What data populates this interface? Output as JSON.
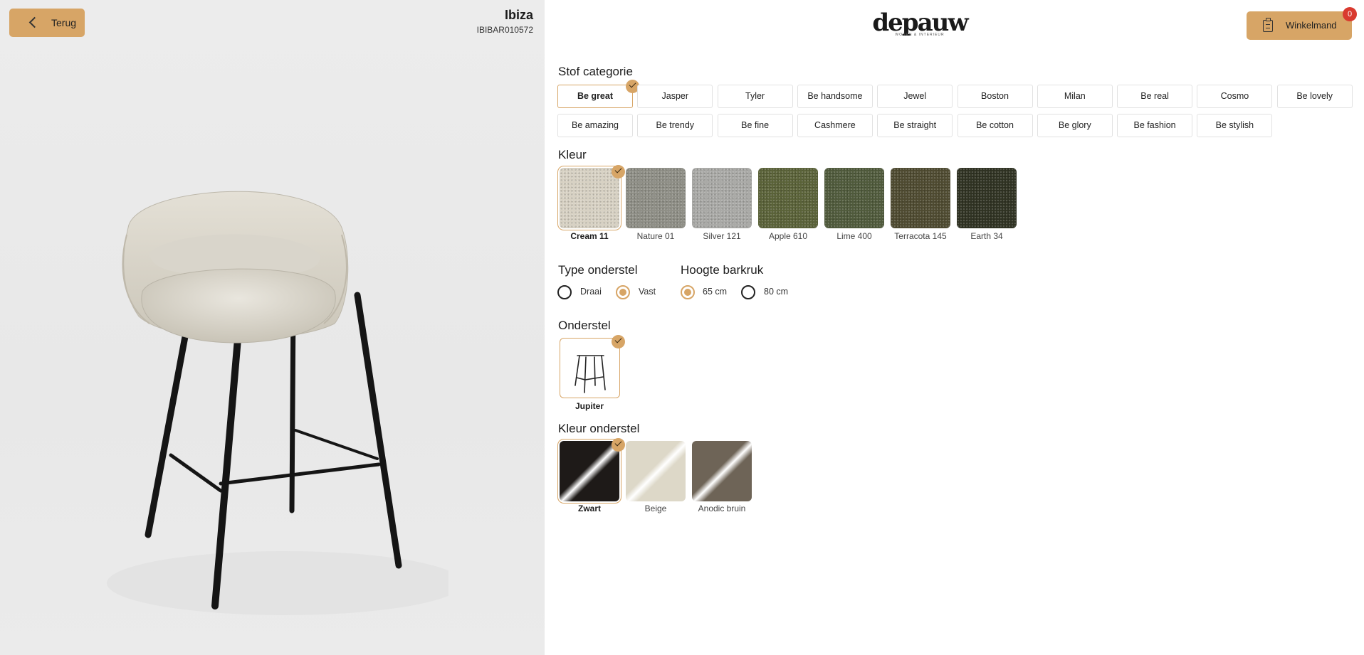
{
  "header": {
    "back_label": "Terug",
    "product_title": "Ibiza",
    "product_code": "IBIBAR010572",
    "logo_word": "depauw",
    "logo_tagline": "WONEN & INTERIEUR",
    "cart_label": "Winkelmand",
    "cart_count": "0"
  },
  "fabric_category": {
    "title": "Stof categorie",
    "selected": "Be great",
    "row1": [
      "Be great",
      "Jasper",
      "Tyler",
      "Be handsome",
      "Jewel",
      "Boston",
      "Milan",
      "Be real",
      "Cosmo",
      "Be lovely"
    ],
    "row2": [
      "Be amazing",
      "Be trendy",
      "Be fine",
      "Cashmere",
      "Be straight",
      "Be cotton",
      "Be glory",
      "Be fashion",
      "Be stylish"
    ]
  },
  "color": {
    "title": "Kleur",
    "selected": "Cream 11",
    "options": [
      {
        "label": "Cream 11",
        "color": "#d7d1c3"
      },
      {
        "label": "Nature 01",
        "color": "#8f8f86"
      },
      {
        "label": "Silver 121",
        "color": "#a9a9a6"
      },
      {
        "label": "Apple 610",
        "color": "#5a6238"
      },
      {
        "label": "Lime 400",
        "color": "#4f5a3b"
      },
      {
        "label": "Terracota 145",
        "color": "#4e4a30"
      },
      {
        "label": "Earth 34",
        "color": "#2f3222"
      }
    ]
  },
  "base_type": {
    "title": "Type onderstel",
    "options": [
      {
        "label": "Draai",
        "selected": false
      },
      {
        "label": "Vast",
        "selected": true
      }
    ]
  },
  "height": {
    "title": "Hoogte barkruk",
    "options": [
      {
        "label": "65 cm",
        "selected": true
      },
      {
        "label": "80 cm",
        "selected": false
      }
    ]
  },
  "base": {
    "title": "Onderstel",
    "selected": "Jupiter",
    "icon": "bar-stool-frame-icon"
  },
  "base_color": {
    "title": "Kleur onderstel",
    "selected": "Zwart",
    "options": [
      {
        "label": "Zwart",
        "color": "#1e1a18"
      },
      {
        "label": "Beige",
        "color": "#ddd8c8"
      },
      {
        "label": "Anodic bruin",
        "color": "#6e6457"
      }
    ]
  }
}
